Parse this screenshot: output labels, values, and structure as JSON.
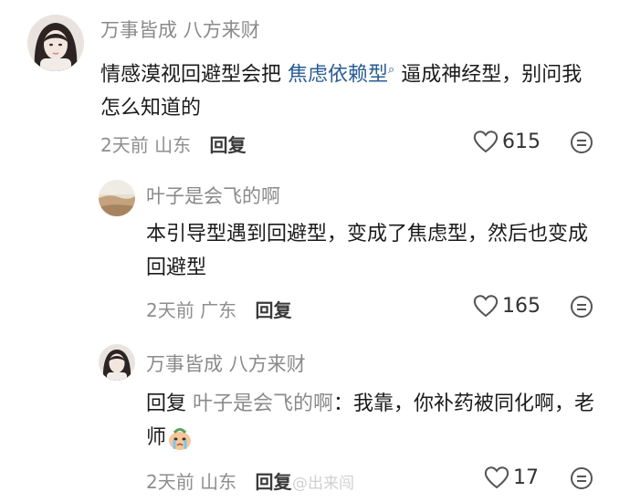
{
  "comments": [
    {
      "username": "万事皆成 八方来财",
      "text_before": "情感漠视回避型会把 ",
      "link_text": "焦虑依赖型",
      "text_after_link": " 逼成神经型，别问我怎么知道的",
      "time": "2天前",
      "location": "山东",
      "reply_label": "回复",
      "likes": "615"
    },
    {
      "username": "叶子是会飞的啊",
      "text": "本引导型遇到回避型，变成了焦虑型，然后也变成回避型",
      "time": "2天前",
      "location": "广东",
      "reply_label": "回复",
      "likes": "165"
    },
    {
      "username": "万事皆成 八方来财",
      "reply_prefix": "回复 ",
      "mention": "叶子是会飞的啊",
      "text": "：我靠，你补药被同化啊，老师",
      "time": "2天前",
      "location": "山东",
      "reply_label": "回复",
      "likes": "17"
    }
  ],
  "watermark": "@出来闯",
  "icons": {
    "like": "heart-outline-icon",
    "more": "comment-smile-icon",
    "link": "search-icon",
    "emoji": "crying-face-emoji"
  },
  "colors": {
    "link": "#2a5d93",
    "secondary_text": "#8e8e8e",
    "primary_text": "#1b1b1b"
  }
}
